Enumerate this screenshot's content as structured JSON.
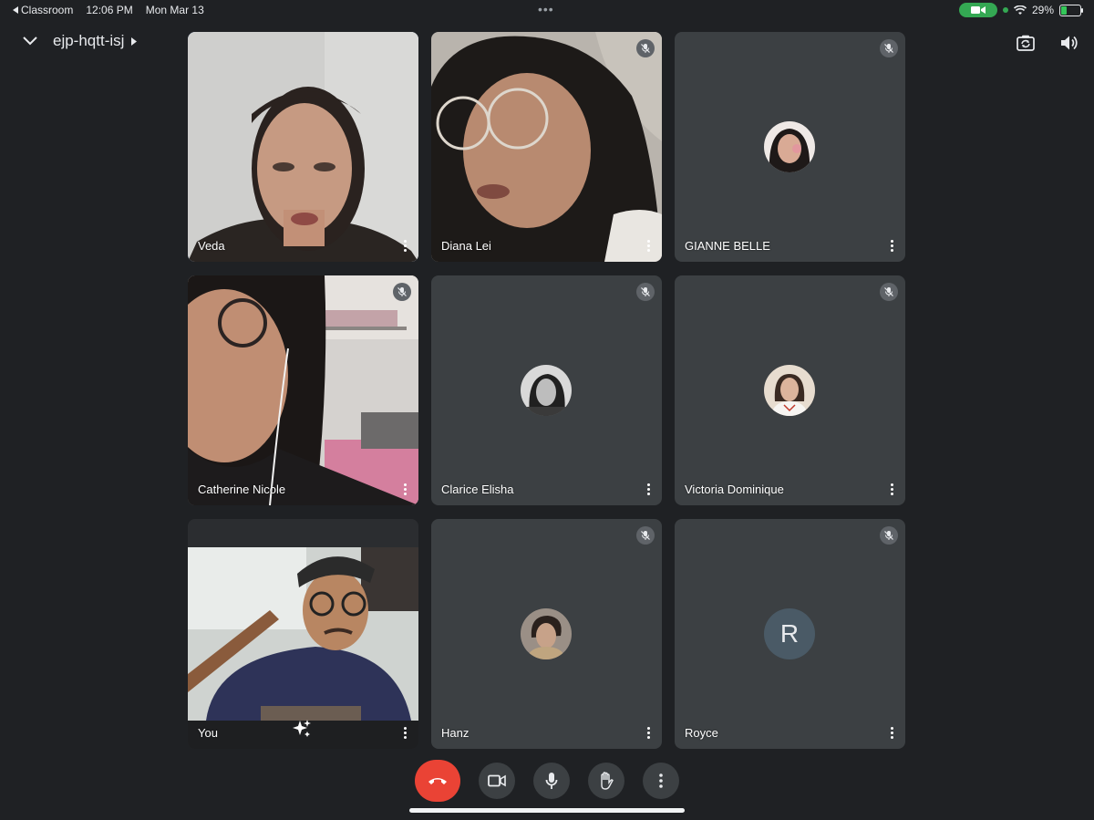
{
  "status_bar": {
    "back_app": "Classroom",
    "time": "12:06 PM",
    "date": "Mon Mar 13",
    "battery": "29%",
    "battery_level": 0.29
  },
  "header": {
    "meeting_code": "ejp-hqtt-isj"
  },
  "participants": [
    {
      "name": "Veda",
      "muted": false,
      "video": true,
      "active": true
    },
    {
      "name": "Diana Lei",
      "muted": true,
      "video": true
    },
    {
      "name": "GIANNE BELLE",
      "muted": true,
      "video": false
    },
    {
      "name": "Catherine Nicole",
      "muted": true,
      "video": true
    },
    {
      "name": "Clarice Elisha",
      "muted": true,
      "video": false
    },
    {
      "name": "Victoria Dominique",
      "muted": true,
      "video": false
    },
    {
      "name": "You",
      "muted": false,
      "video": true
    },
    {
      "name": "Hanz",
      "muted": true,
      "video": false
    },
    {
      "name": "Royce",
      "muted": true,
      "video": false,
      "avatar_letter": "R"
    }
  ],
  "colors": {
    "background": "#1f2124",
    "tile": "#3c4043",
    "active_border": "#8ab4f8",
    "end_call": "#ea4335",
    "avatar_R": "#4a5a66"
  },
  "controls": [
    "end-call-icon",
    "camera-icon",
    "microphone-icon",
    "raise-hand-icon",
    "more-options-icon"
  ]
}
